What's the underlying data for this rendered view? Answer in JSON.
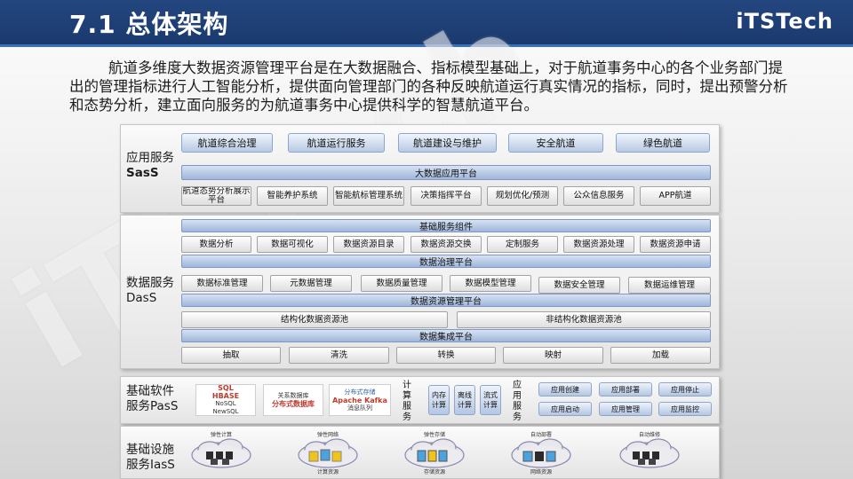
{
  "header": {
    "title": "7.1 总体架构",
    "brand": "iTSTech",
    "watermark": "iTSTech",
    "bg_color": "#1f3f75"
  },
  "intro": "航道多维度大数据资源管理平台是在大数据融合、指标模型基础上，对于航道事务中心的各个业务部门提出的管理指标进行人工智能分析，提供面向管理部门的各种反映航道运行真实情况的指标，同时，提出预警分析和态势分析，建立面向服务的为航道事务中心提供科学的智慧航道平台。",
  "saas": {
    "label_cn": "应用服务",
    "label_en": "SasS",
    "top_row": [
      "航道综合治理",
      "航道运行服务",
      "航道建设与维护",
      "安全航道",
      "绿色航道"
    ],
    "platform": "大数据应用平台",
    "bottom_row": [
      "航道态势分析展示平台",
      "智能养护系统",
      "智能航标管理系统",
      "决策指挥平台",
      "规划优化/预测",
      "公众信息服务",
      "APP航道"
    ]
  },
  "daas": {
    "label_cn": "数据服务",
    "label_en": "DasS",
    "basic_components": "基础服务组件",
    "service_row": [
      "数据分析",
      "数据可视化",
      "数据资源目录",
      "数据资源交换",
      "定制服务",
      "数据资源处理",
      "数据资源申请"
    ],
    "governance": "数据治理平台",
    "governance_row": [
      "数据标准管理",
      "元数据管理",
      "数据质量管理",
      "数据模型管理",
      "数据安全管理",
      "数据运维管理"
    ],
    "resource_mgmt": "数据资源管理平台",
    "structured_pool": "结构化数据资源池",
    "unstructured_pool": "非结构化数据资源池",
    "integration": "数据集成平台",
    "etl_row": [
      "抽取",
      "清洗",
      "转换",
      "映射",
      "加载"
    ]
  },
  "paas": {
    "label_cn1": "基础软件",
    "label_cn2": "服务PasS",
    "logos": [
      {
        "lines": [
          "SQL",
          "HBASE",
          "NoSQL",
          "NewSQL"
        ]
      },
      {
        "lines": [
          "关系数据库",
          "分布式数据库"
        ]
      },
      {
        "lines": [
          "分布式存储",
          "Apache Kafka",
          "消息队列"
        ]
      }
    ],
    "compute_label": "计算服务",
    "compute": [
      "内存计算",
      "离线计算",
      "流式计算"
    ],
    "app_label": "应用服务",
    "apps": [
      "应用创建",
      "应用部署",
      "应用停止",
      "应用启动",
      "应用管理",
      "应用监控"
    ]
  },
  "iaas": {
    "label_cn1": "基础设施",
    "label_cn2": "服务IasS",
    "clouds": [
      {
        "top": "弹性计算",
        "bottom": ""
      },
      {
        "top": "弹性网络",
        "bottom": "计算资源"
      },
      {
        "top": "弹性存储",
        "bottom": "存储资源"
      },
      {
        "top": "自动部署",
        "bottom": "网络资源"
      },
      {
        "top": "自动维修",
        "bottom": ""
      }
    ]
  }
}
